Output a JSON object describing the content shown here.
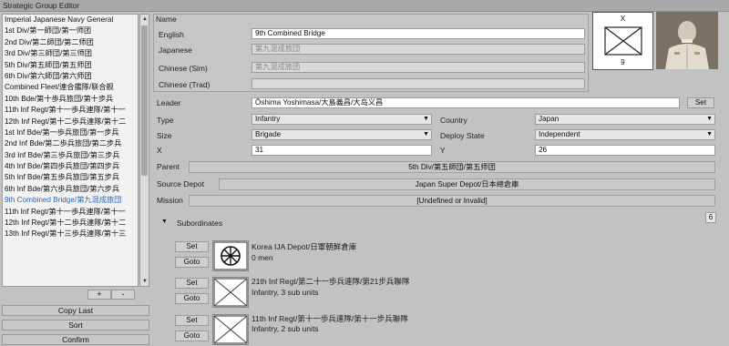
{
  "window": {
    "title": "Strategic Group Editor"
  },
  "list": {
    "items": [
      "Imperial Japanese Navy General",
      "1st Div/第一師団/第一师团",
      "2nd Div/第二師団/第二师团",
      "3rd Div/第三師団/第三师团",
      "5th Div/第五師団/第五师团",
      "6th Div/第六師団/第六师团",
      "Combined Fleet/連合艦隊/联合舰",
      "10th Bde/第十歩兵旅団/第十步兵",
      "11th Inf Regt/第十一歩兵連隊/第十一",
      "12th Inf Regt/第十二歩兵連隊/第十二",
      "1st Inf Bde/第一歩兵旅団/第一步兵",
      "2nd Inf Bde/第二歩兵旅団/第二步兵",
      "3rd Inf Bde/第三歩兵旅団/第三步兵",
      "4th Inf Bde/第四歩兵旅団/第四步兵",
      "5th Inf Bde/第五歩兵旅団/第五步兵",
      "6th Inf Bde/第六歩兵旅団/第六步兵",
      "9th Combined Bridge/第九混成旅団",
      "11th Inf Regt/第十一歩兵連隊/第十一",
      "12th Inf Regt/第十二歩兵連隊/第十二",
      "13th Inf Regt/第十三歩兵連隊/第十三"
    ],
    "selected_index": 16,
    "plus_label": "+",
    "minus_label": "-"
  },
  "buttons": {
    "copy_last": "Copy Last",
    "sort": "Sort",
    "confirm": "Confirm"
  },
  "name": {
    "header": "Name",
    "english_label": "English",
    "english_value": "9th Combined Bridge",
    "japanese_label": "Japanese",
    "japanese_value": "第九混成旅団",
    "chinese_sim_label": "Chinese (Sim)",
    "chinese_sim_value": "第九混成旅团",
    "chinese_trad_label": "Chinese (Trad)",
    "chinese_trad_value": ""
  },
  "flag": {
    "top": "X",
    "bottom": "9"
  },
  "leader": {
    "label": "Leader",
    "value": "Ōshima Yoshimasa/大島義昌/大岛义昌",
    "set": "Set"
  },
  "type": {
    "label": "Type",
    "value": "Infantry"
  },
  "country": {
    "label": "Country",
    "value": "Japan"
  },
  "size": {
    "label": "Size",
    "value": "Brigade"
  },
  "deploy": {
    "label": "Deploy State",
    "value": "Independent"
  },
  "x": {
    "label": "X",
    "value": "31"
  },
  "y": {
    "label": "Y",
    "value": "26"
  },
  "parent": {
    "label": "Parent",
    "value": "5th Div/第五師団/第五师团"
  },
  "source_depot": {
    "label": "Source Depot",
    "value": "Japan Super Depot/日本總倉庫"
  },
  "mission": {
    "label": "Mission",
    "value": "[Undefined or Invalid]"
  },
  "subordinates": {
    "label": "Subordinates",
    "count": "6",
    "set": "Set",
    "goto": "Goto",
    "items": [
      {
        "name": "Korea IJA Depot/日軍朝鮮倉庫",
        "detail": "0 men",
        "icon": "depot"
      },
      {
        "name": "21th Inf Regt/第二十一歩兵連隊/第21步兵聯隊",
        "detail": "Infantry, 3 sub units",
        "icon": "infantry"
      },
      {
        "name": "11th Inf Regt/第十一歩兵連隊/第十一步兵聯隊",
        "detail": "Infantry, 2 sub units",
        "icon": "infantry"
      }
    ]
  }
}
